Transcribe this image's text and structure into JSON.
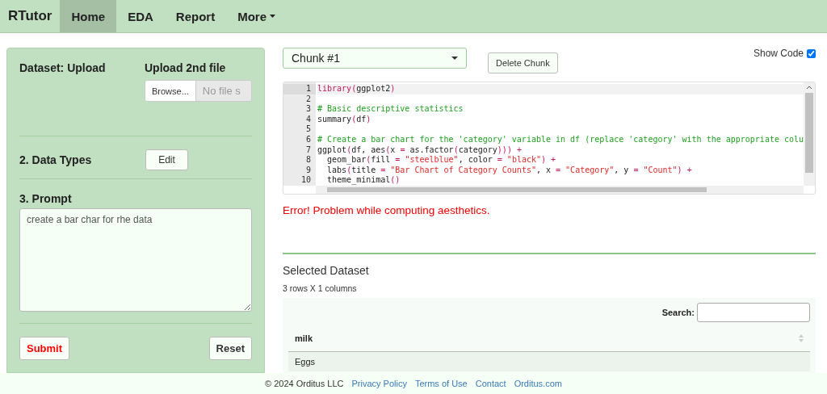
{
  "navbar": {
    "brand": "RTutor",
    "tabs": [
      {
        "label": "Home",
        "selected": true,
        "dropdown": false
      },
      {
        "label": "EDA",
        "selected": false,
        "dropdown": false
      },
      {
        "label": "Report",
        "selected": false,
        "dropdown": false
      },
      {
        "label": "More",
        "selected": false,
        "dropdown": true
      }
    ]
  },
  "sidebar": {
    "dataset_label": "Dataset: Upload",
    "upload_label": "Upload 2nd file",
    "browse_button": "Browse...",
    "file_placeholder": "No file s",
    "data_types_label": "2. Data Types",
    "edit_button": "Edit",
    "prompt_label": "3. Prompt",
    "prompt_value": "create a bar char for rhe data",
    "submit_button": "Submit",
    "reset_button": "Reset"
  },
  "chunk_select": {
    "value": "Chunk #1"
  },
  "delete_button": "Delete Chunk",
  "show_code": {
    "label": "Show Code",
    "checked": true
  },
  "code": [
    {
      "number": "1",
      "tokens": [
        {
          "kind": "fn",
          "text": "library("
        },
        {
          "kind": "plain",
          "text": "ggplot2"
        },
        {
          "kind": "fn",
          "text": ")"
        }
      ]
    },
    {
      "number": "2"
    },
    {
      "number": "3",
      "tokens": [
        {
          "kind": "comment",
          "text": "# Basic descriptive statistics"
        }
      ]
    },
    {
      "number": "4",
      "tokens": [
        {
          "kind": "plain",
          "text": "summary"
        },
        {
          "kind": "fn",
          "text": "("
        },
        {
          "kind": "plain",
          "text": "df"
        },
        {
          "kind": "fn",
          "text": ")"
        }
      ]
    },
    {
      "number": "5"
    },
    {
      "number": "6",
      "tokens": [
        {
          "kind": "comment",
          "text": "# Create a bar chart for the 'category' variable in df (replace 'category' with the appropriate colu"
        }
      ]
    },
    {
      "number": "7",
      "tokens": [
        {
          "kind": "plain",
          "text": "ggplot"
        },
        {
          "kind": "fn",
          "text": "("
        },
        {
          "kind": "plain",
          "text": "df, aes"
        },
        {
          "kind": "fn",
          "text": "("
        },
        {
          "kind": "plain",
          "text": "x "
        },
        {
          "kind": "fn",
          "text": "="
        },
        {
          "kind": "plain",
          "text": " as.factor"
        },
        {
          "kind": "fn",
          "text": "("
        },
        {
          "kind": "plain",
          "text": "category"
        },
        {
          "kind": "fn",
          "text": "))) +"
        }
      ]
    },
    {
      "number": "8",
      "tokens": [
        {
          "kind": "plain",
          "text": "  geom_bar"
        },
        {
          "kind": "fn",
          "text": "("
        },
        {
          "kind": "plain",
          "text": "fill "
        },
        {
          "kind": "fn",
          "text": "="
        },
        {
          "kind": "string",
          "text": " \"steelblue\""
        },
        {
          "kind": "plain",
          "text": ", color "
        },
        {
          "kind": "fn",
          "text": "="
        },
        {
          "kind": "string",
          "text": " \"black\""
        },
        {
          "kind": "fn",
          "text": ") +"
        }
      ]
    },
    {
      "number": "9",
      "tokens": [
        {
          "kind": "plain",
          "text": "  labs"
        },
        {
          "kind": "fn",
          "text": "("
        },
        {
          "kind": "plain",
          "text": "title "
        },
        {
          "kind": "fn",
          "text": "="
        },
        {
          "kind": "string",
          "text": " \"Bar Chart of Category Counts\""
        },
        {
          "kind": "plain",
          "text": ", x "
        },
        {
          "kind": "fn",
          "text": "="
        },
        {
          "kind": "string",
          "text": " \"Category\""
        },
        {
          "kind": "plain",
          "text": ", y "
        },
        {
          "kind": "fn",
          "text": "="
        },
        {
          "kind": "string",
          "text": " \"Count\""
        },
        {
          "kind": "fn",
          "text": ") +"
        }
      ]
    },
    {
      "number": "10",
      "tokens": [
        {
          "kind": "plain",
          "text": "  theme_minimal"
        },
        {
          "kind": "fn",
          "text": "()"
        }
      ]
    }
  ],
  "error": "Error! Problem while computing aesthetics.",
  "dataset": {
    "title": "Selected Dataset",
    "summary": "3 rows X 1 columns",
    "search_label": "Search:",
    "columns": [
      "milk"
    ],
    "rows": [
      [
        "Eggs"
      ]
    ]
  },
  "footer": {
    "copyright": "© 2024 Orditus LLC",
    "links": [
      "Privacy Policy",
      "Terms of Use",
      "Contact",
      "Orditus.com"
    ]
  }
}
